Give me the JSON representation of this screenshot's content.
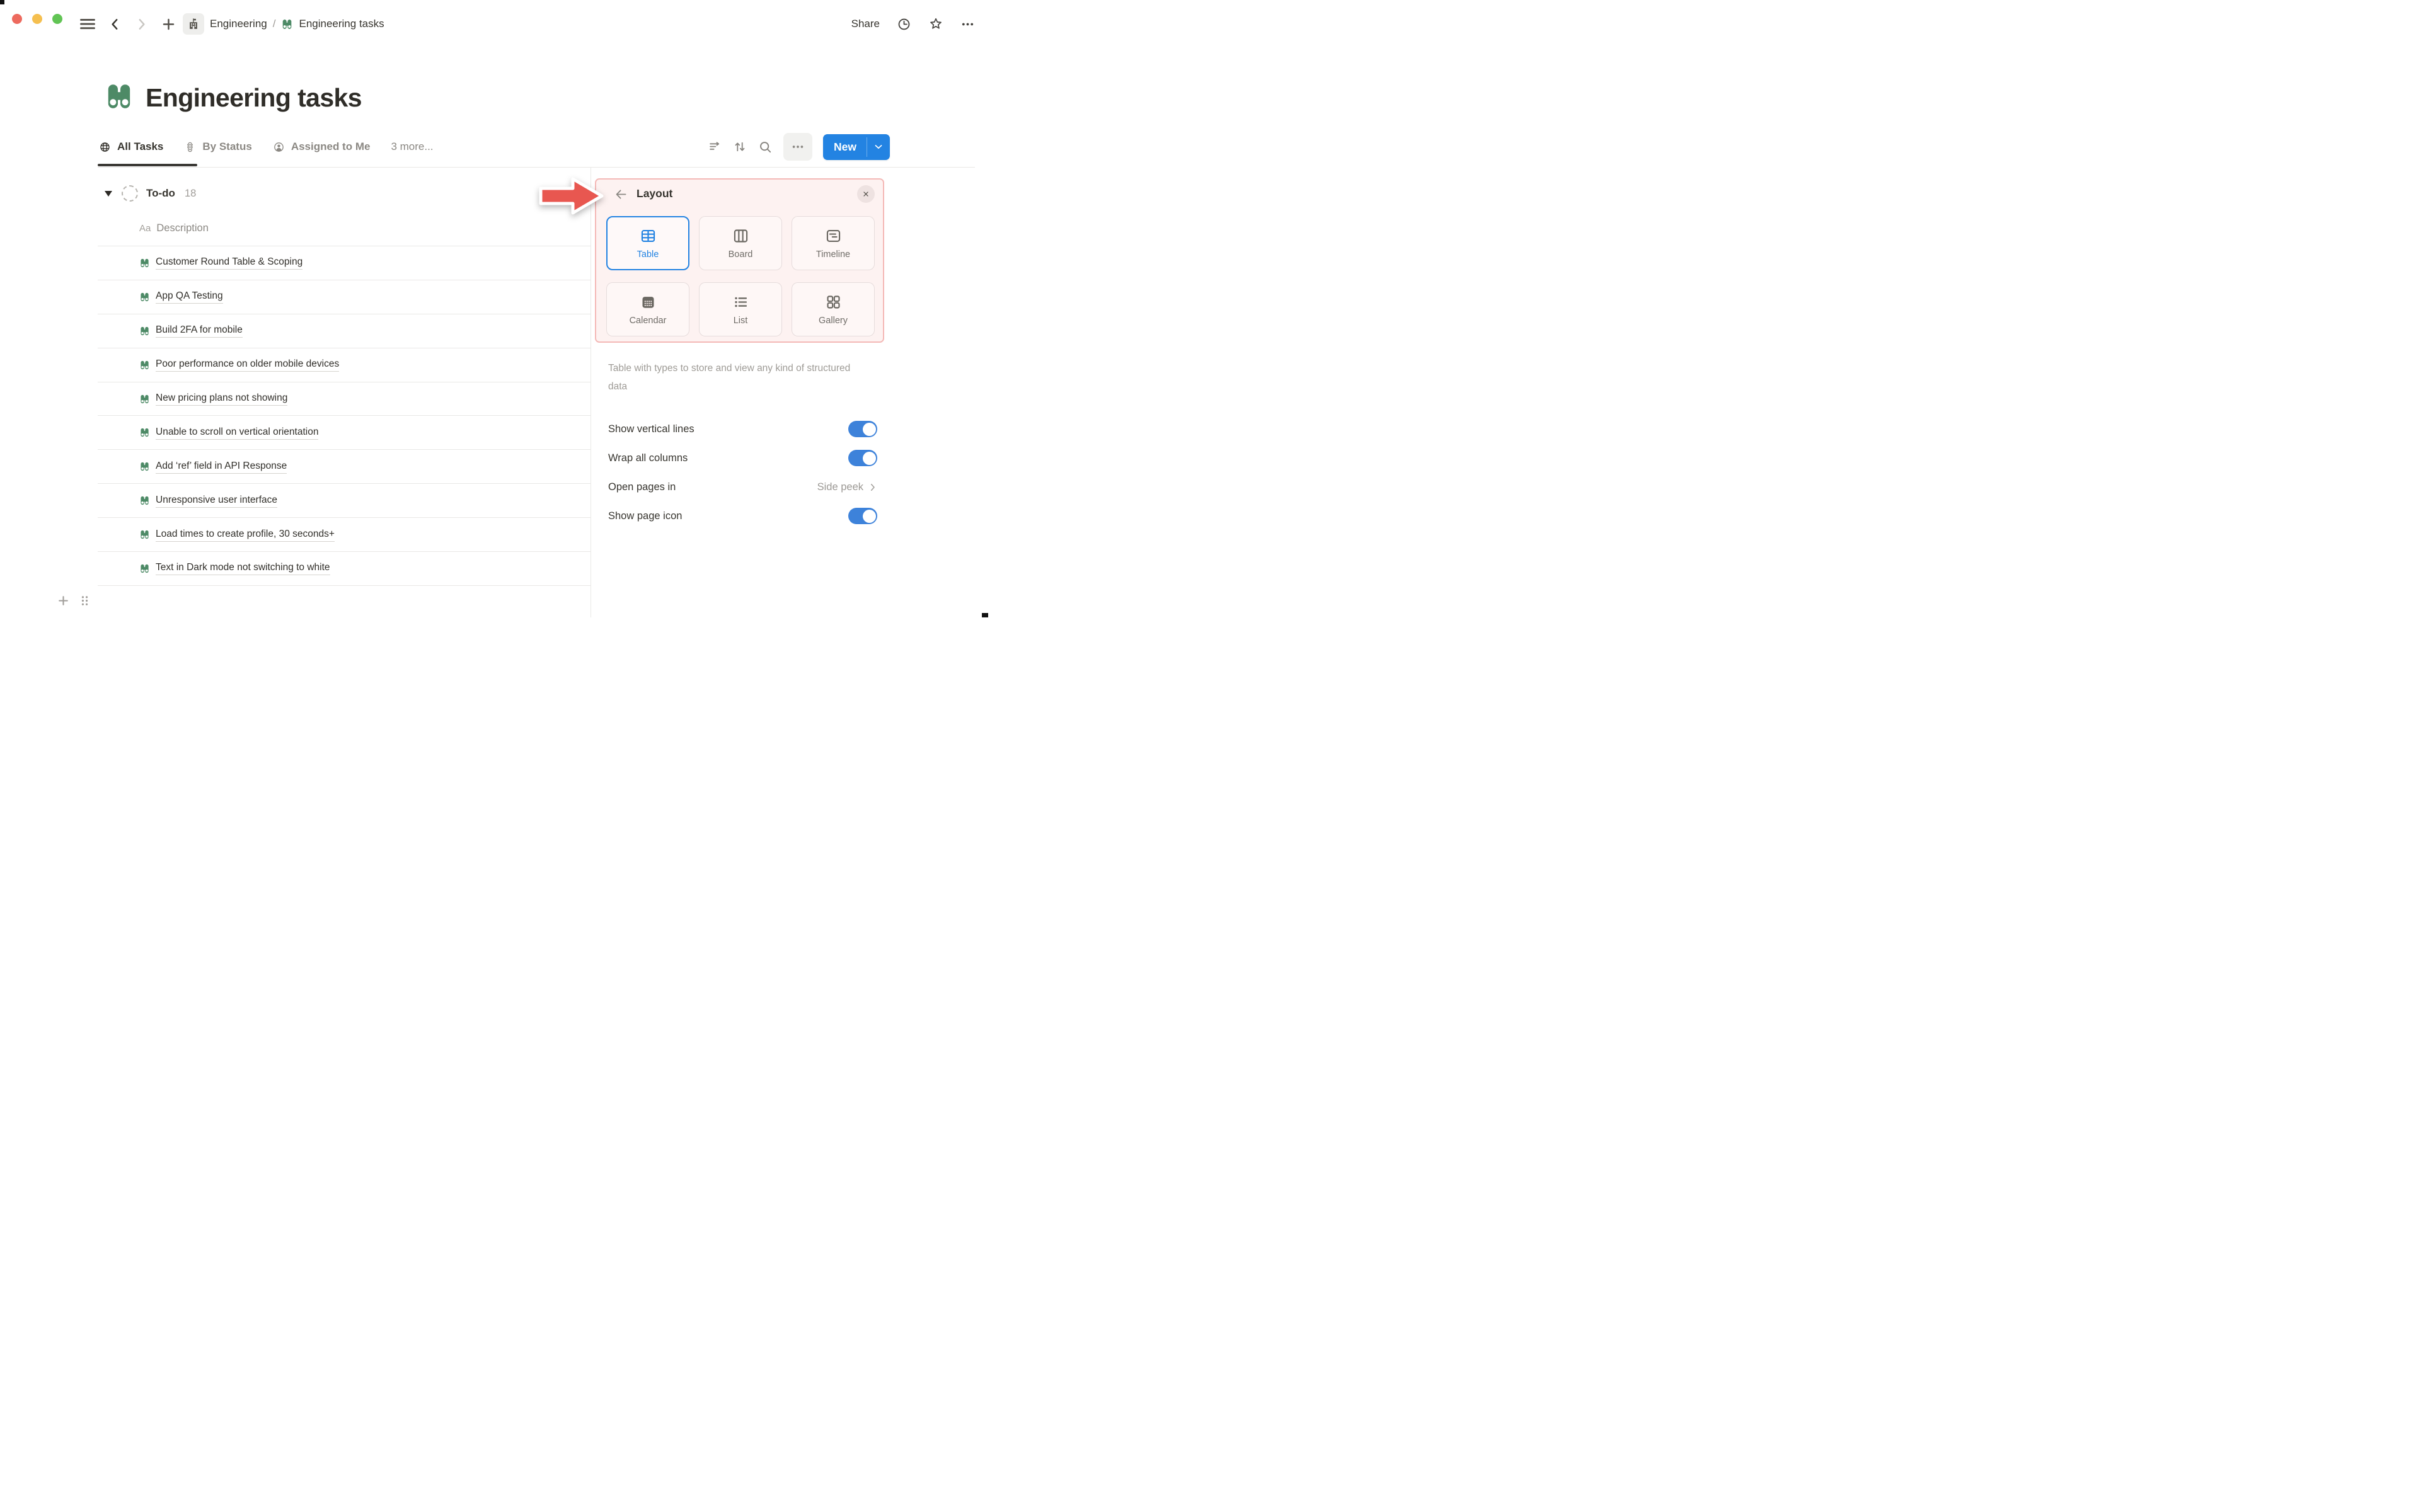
{
  "colors": {
    "accent_blue": "#2383e2",
    "toggle_blue": "#3d82da",
    "notion_green": "#4d8a66",
    "highlight_pink_bg": "#fdf2f1",
    "highlight_pink_border": "#f4b9b7",
    "annotation_red": "#e85750"
  },
  "topbar": {
    "breadcrumb": {
      "workspace": "Engineering",
      "separator": "/",
      "page": "Engineering tasks"
    },
    "share_label": "Share"
  },
  "page": {
    "title": "Engineering tasks"
  },
  "tabs": {
    "all_tasks": "All Tasks",
    "by_status": "By Status",
    "assigned_to_me": "Assigned to Me",
    "more": "3 more..."
  },
  "toolbar": {
    "new_label": "New"
  },
  "table": {
    "group": {
      "name": "To-do",
      "count": "18"
    },
    "header": {
      "type": "Aa",
      "name": "Description"
    },
    "rows": [
      "Customer Round Table & Scoping",
      "App QA Testing",
      "Build 2FA for mobile",
      "Poor performance on older mobile devices",
      "New pricing plans not showing",
      "Unable to scroll on vertical orientation",
      "Add ‘ref’ field in API Response",
      "Unresponsive user interface",
      "Load times to create profile, 30 seconds+",
      "Text in Dark mode not switching to white"
    ]
  },
  "panel": {
    "title": "Layout",
    "options": [
      {
        "label": "Table",
        "selected": true
      },
      {
        "label": "Board",
        "selected": false
      },
      {
        "label": "Timeline",
        "selected": false
      },
      {
        "label": "Calendar",
        "selected": false
      },
      {
        "label": "List",
        "selected": false
      },
      {
        "label": "Gallery",
        "selected": false
      }
    ],
    "description": "Table with types to store and view any kind of structured data",
    "settings": {
      "vertical_lines": "Show vertical lines",
      "wrap_columns": "Wrap all columns",
      "open_pages": "Open pages in",
      "open_pages_value": "Side peek",
      "page_icon": "Show page icon"
    }
  }
}
